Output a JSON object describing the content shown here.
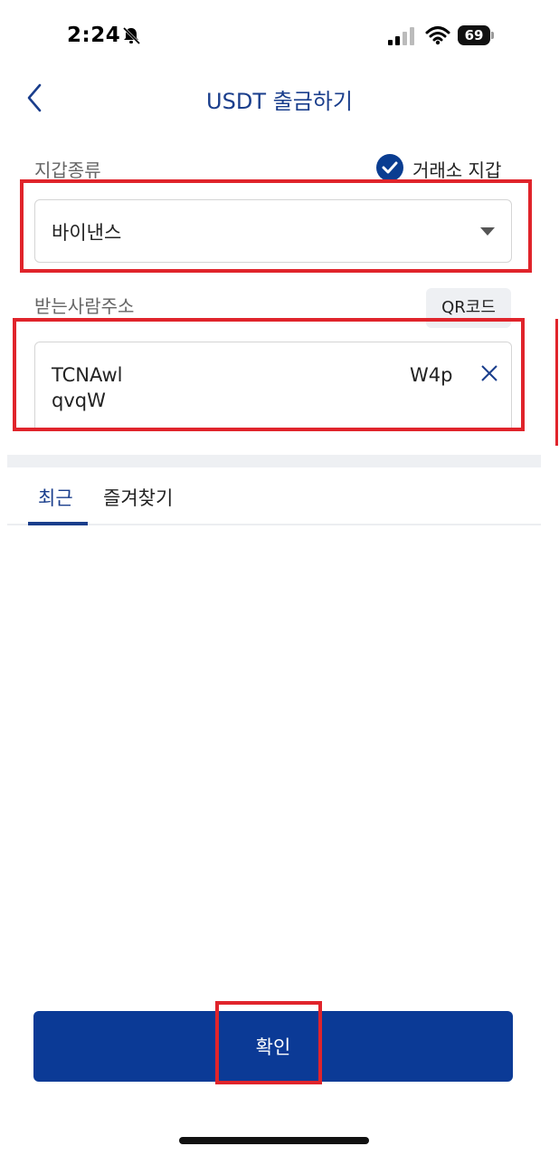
{
  "status_bar": {
    "time": "2:24",
    "battery": "69"
  },
  "header": {
    "title": "USDT 출금하기"
  },
  "wallet": {
    "label": "지갑종류",
    "exchange_wallet_label": "거래소 지갑",
    "exchange_wallet_checked": true,
    "selected": "바이낸스"
  },
  "recipient": {
    "label": "받는사람주소",
    "qr_button": "QR코드",
    "address_line1_start": "TCNAwl",
    "address_line1_end": "W4p",
    "address_line2": "qvqW"
  },
  "tabs": [
    {
      "label": "최근",
      "active": true
    },
    {
      "label": "즐겨찾기",
      "active": false
    }
  ],
  "confirm_label": "확인",
  "colors": {
    "brand": "#0b3a96",
    "highlight": "#e0242b"
  }
}
